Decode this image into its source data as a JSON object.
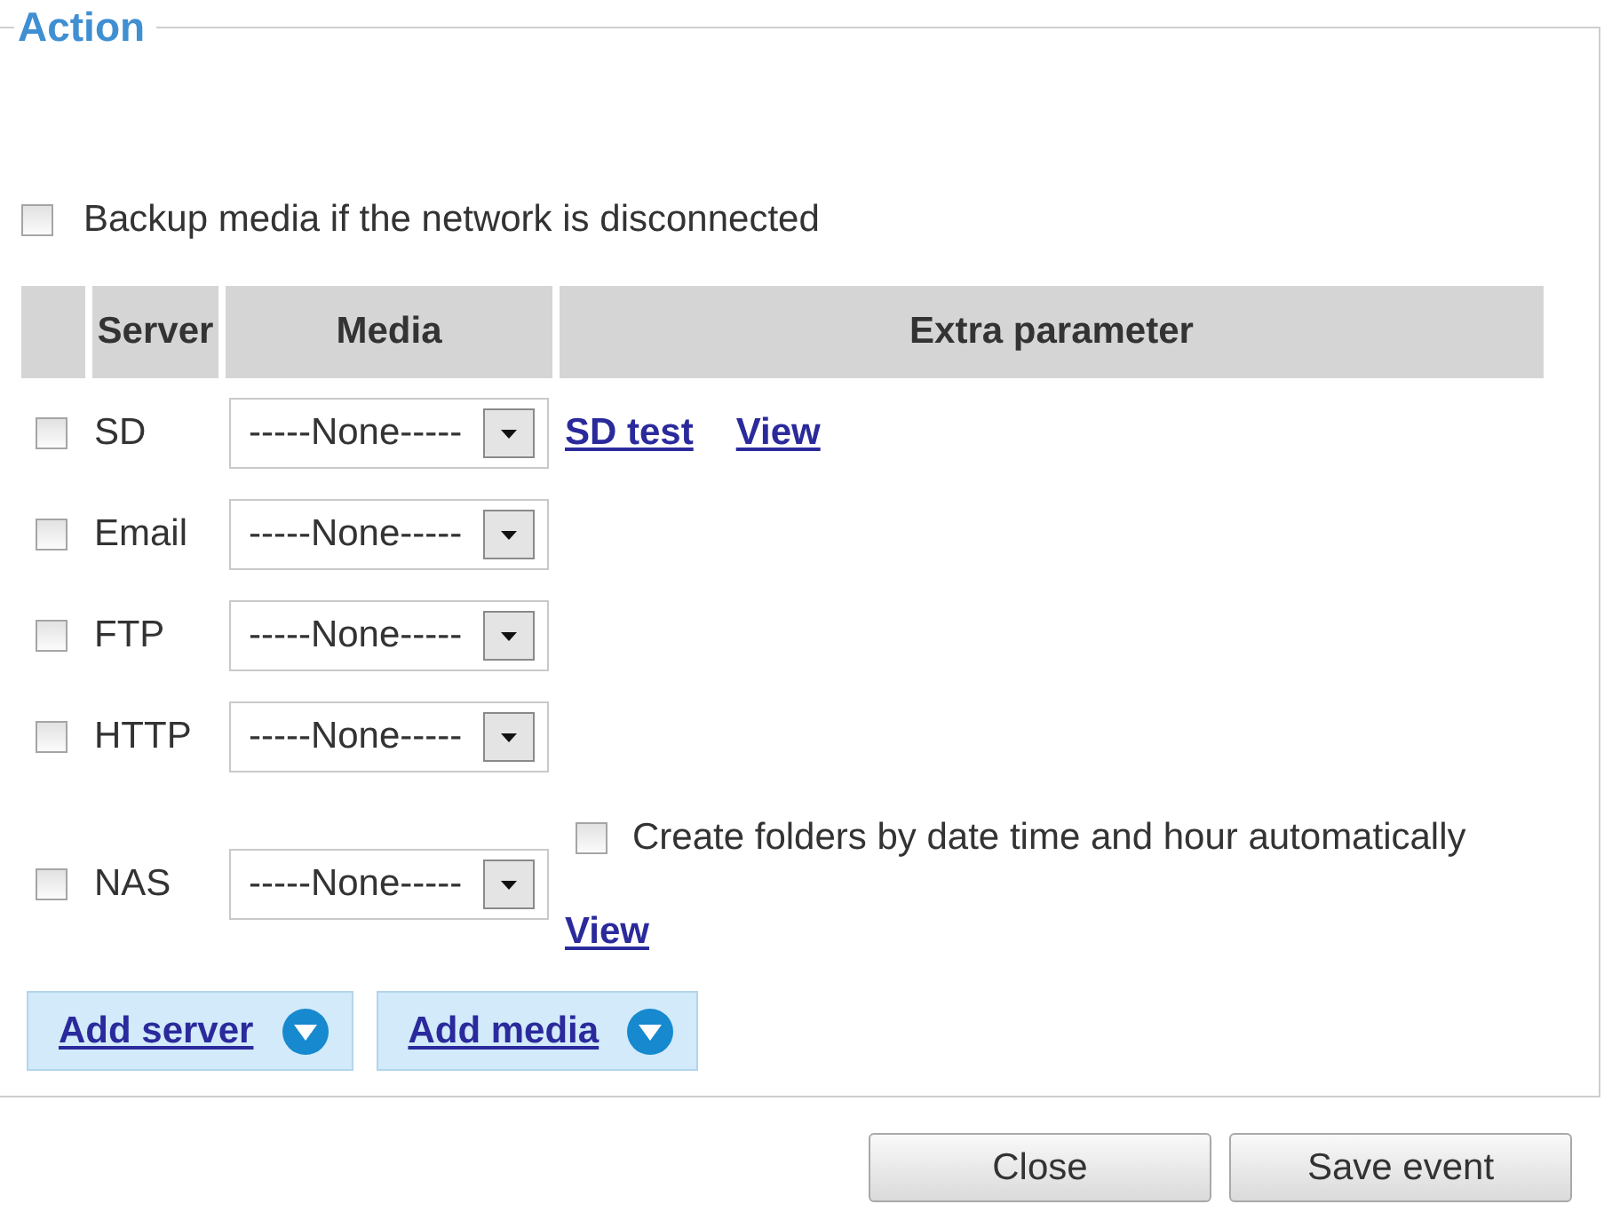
{
  "panel": {
    "legend": "Action"
  },
  "backup_option": {
    "label": "Backup media if the network is disconnected",
    "checked": false
  },
  "table": {
    "columns": [
      "Server",
      "Media",
      "Extra parameter"
    ],
    "rows": [
      {
        "server": "SD",
        "checked": false,
        "media": "-----None-----",
        "extra": [
          {
            "kind": "link",
            "text": "SD test"
          },
          {
            "kind": "link",
            "text": "View"
          }
        ]
      },
      {
        "server": "Email",
        "checked": false,
        "media": "-----None-----"
      },
      {
        "server": "FTP",
        "checked": false,
        "media": "-----None-----"
      },
      {
        "server": "HTTP",
        "checked": false,
        "media": "-----None-----"
      },
      {
        "server": "NAS",
        "checked": false,
        "media": "-----None-----",
        "extra": [
          {
            "kind": "checkbox",
            "label": "Create folders by date time and hour automatically",
            "checked": false
          },
          {
            "kind": "link",
            "text": "View"
          }
        ]
      }
    ]
  },
  "add_buttons": [
    "Add server",
    "Add media"
  ],
  "footer_buttons": [
    "Close",
    "Save event"
  ]
}
